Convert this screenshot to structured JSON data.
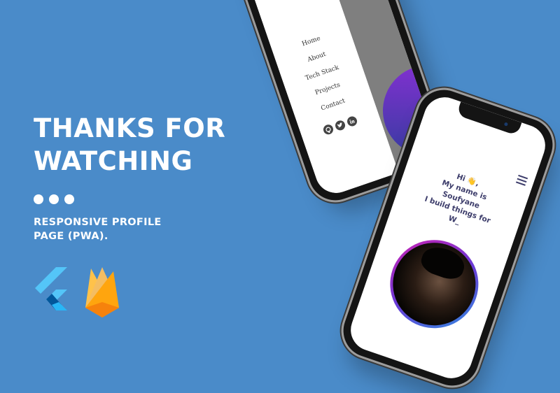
{
  "headline": {
    "line1": "THANKS FOR",
    "line2": "WATCHING"
  },
  "subtitle": {
    "line1": "RESPONSIVE PROFILE",
    "line2": "PAGE (PWA)."
  },
  "logos": [
    "flutter-logo",
    "firebase-logo"
  ],
  "colors": {
    "background": "#4a8bc9",
    "text": "#ffffff",
    "accent_text": "#3d3d6b",
    "avatar_ring": [
      "#d01fb0",
      "#6a3ad6",
      "#2f8ee0"
    ]
  },
  "phone_left": {
    "menu": [
      "Home",
      "About",
      "Tech Stack",
      "Projects",
      "Contact"
    ],
    "social_icons": [
      "github-icon",
      "twitter-icon",
      "linkedin-icon"
    ]
  },
  "phone_right": {
    "intro_lines": [
      "Hi 👋,",
      "My name is",
      "Soufyane",
      "I build things for",
      "W_"
    ],
    "menu_icon": "hamburger-icon"
  }
}
